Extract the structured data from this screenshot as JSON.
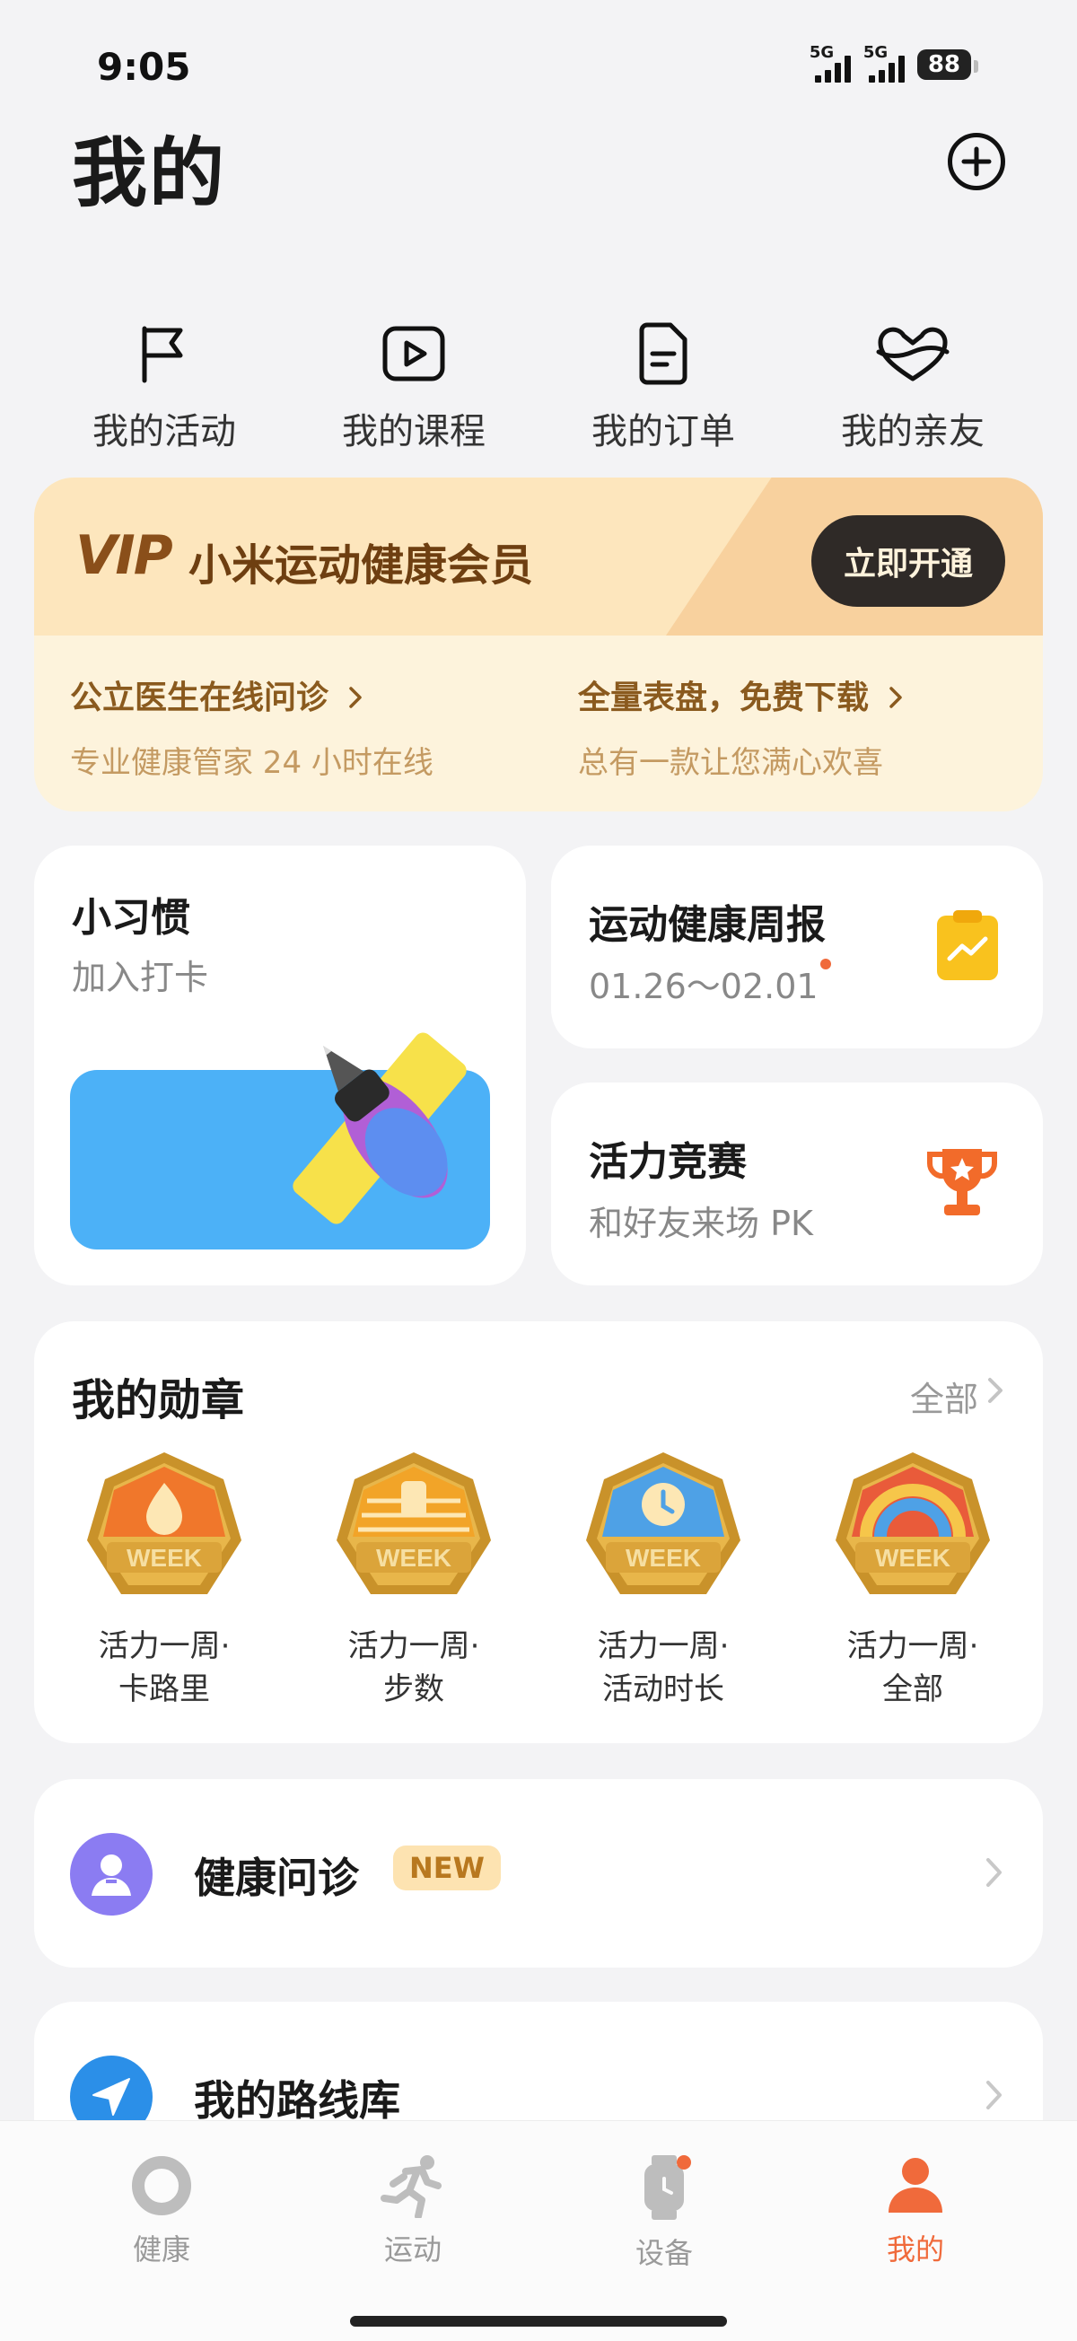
{
  "status_bar": {
    "time": "9:05",
    "network1": "5G",
    "network2": "5G",
    "battery": "88"
  },
  "header": {
    "title": "我的"
  },
  "quick_links": [
    {
      "label": "我的活动",
      "icon": "flag-icon"
    },
    {
      "label": "我的课程",
      "icon": "play-icon"
    },
    {
      "label": "我的订单",
      "icon": "document-icon"
    },
    {
      "label": "我的亲友",
      "icon": "heart-icon"
    }
  ],
  "vip": {
    "logo": "VIP",
    "name": "小米运动健康会员",
    "button": "立即开通",
    "left_title": "公立医生在线问诊",
    "left_sub": "专业健康管家 24 小时在线",
    "right_title": "全量表盘，免费下载",
    "right_sub": "总有一款让您满心欢喜"
  },
  "habit": {
    "title": "小习惯",
    "subtitle": "加入打卡"
  },
  "weekly": {
    "title": "运动健康周报",
    "subtitle": "01.26～02.01"
  },
  "contest": {
    "title": "活力竞赛",
    "subtitle": "和好友来场 PK"
  },
  "badges": {
    "title": "我的勋章",
    "all": "全部",
    "badge_text": "WEEK",
    "items": [
      {
        "line1": "活力一周·",
        "line2": "卡路里",
        "color": "#f0772b"
      },
      {
        "line1": "活力一周·",
        "line2": "步数",
        "color": "#f2a428"
      },
      {
        "line1": "活力一周·",
        "line2": "活动时长",
        "color": "#4ea1e6"
      },
      {
        "line1": "活力一周·",
        "line2": "全部",
        "color": "#e95b3a"
      }
    ]
  },
  "list": {
    "health_consult": "健康问诊",
    "new_tag": "NEW",
    "route_library": "我的路线库"
  },
  "nav": [
    {
      "label": "健康",
      "icon": "health-ring-icon"
    },
    {
      "label": "运动",
      "icon": "runner-icon"
    },
    {
      "label": "设备",
      "icon": "watch-icon"
    },
    {
      "label": "我的",
      "icon": "profile-icon"
    }
  ],
  "colors": {
    "accent": "#f06a3b",
    "vip_brown": "#6e3f11",
    "background": "#f3f3f5"
  }
}
